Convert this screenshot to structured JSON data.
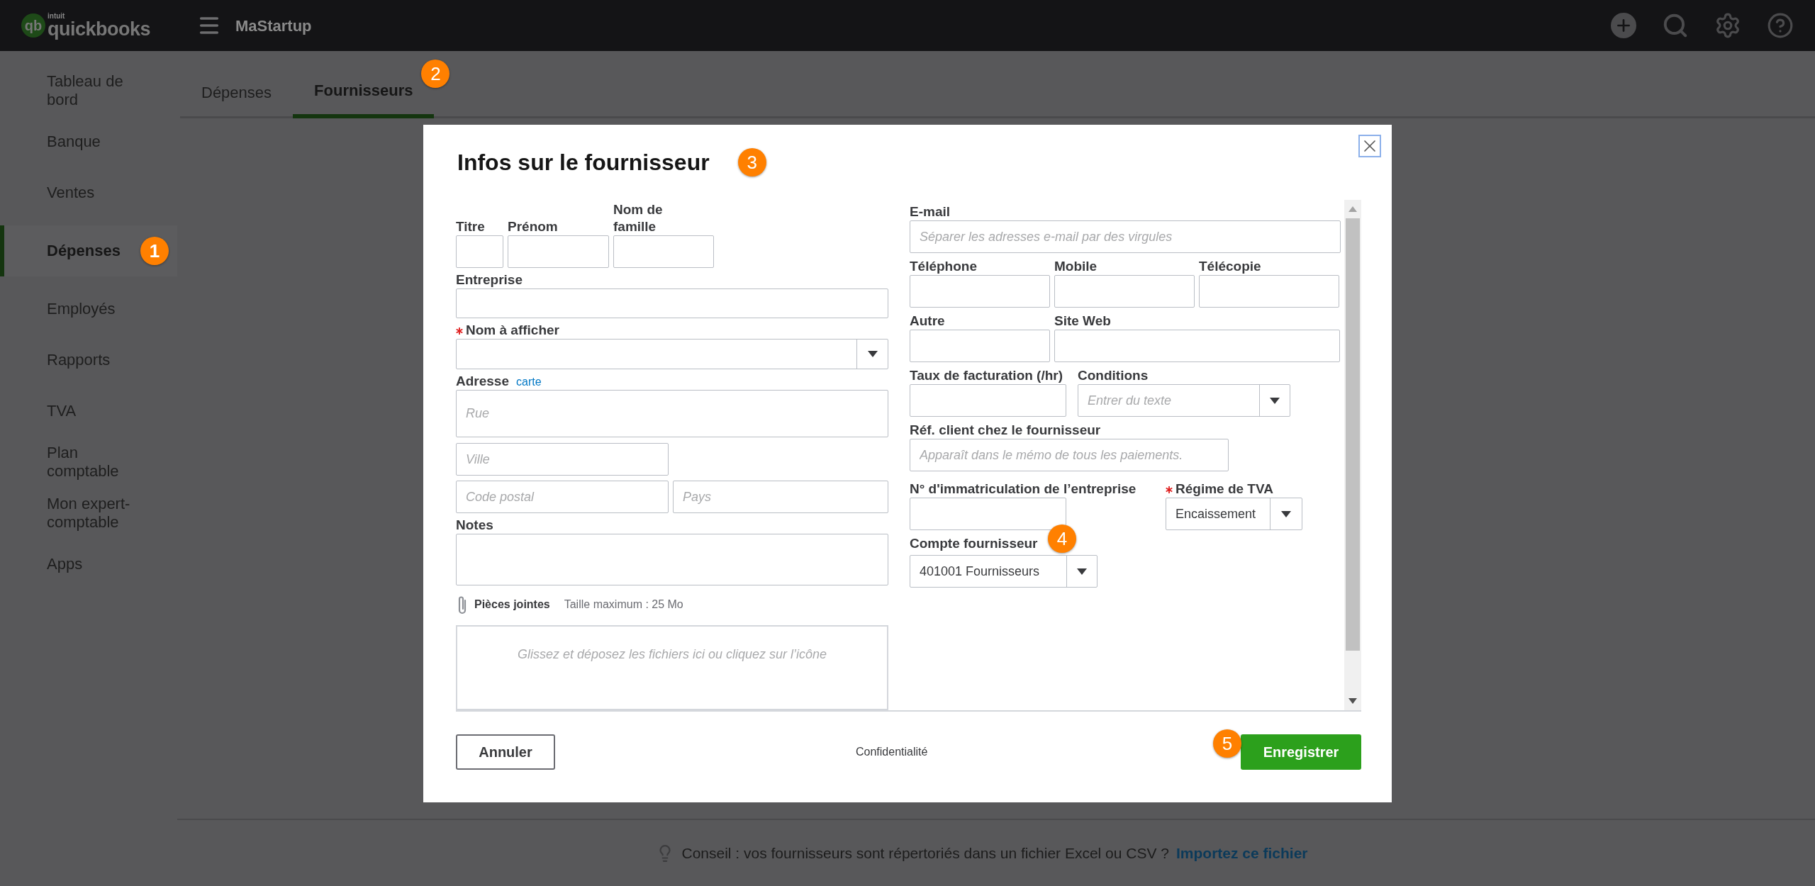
{
  "header": {
    "logo_mark": "qb",
    "brand_small": "intuit",
    "brand": "quickbooks",
    "company": "MaStartup"
  },
  "sidebar": {
    "items": [
      {
        "label": "Tableau de bord",
        "selected": false
      },
      {
        "label": "Banque",
        "selected": false
      },
      {
        "label": "Ventes",
        "selected": false
      },
      {
        "label": "Dépenses",
        "selected": true,
        "callout": "1"
      },
      {
        "label": "Employés",
        "selected": false
      },
      {
        "label": "Rapports",
        "selected": false
      },
      {
        "label": "TVA",
        "selected": false
      },
      {
        "label": "Plan comptable",
        "selected": false
      },
      {
        "label": "Mon expert-comptable",
        "selected": false
      },
      {
        "label": "Apps",
        "selected": false
      }
    ]
  },
  "tabs": [
    {
      "label": "Dépenses",
      "selected": false
    },
    {
      "label": "Fournisseurs",
      "selected": true,
      "callout": "2"
    }
  ],
  "dialog": {
    "title": "Infos sur le fournisseur",
    "callout": "3",
    "name_fields": [
      {
        "label": "Titre"
      },
      {
        "label": "Prénom"
      },
      {
        "label": "Nom de famille"
      }
    ],
    "company": {
      "label": "Entreprise"
    },
    "display_name": {
      "label": "Nom à afficher",
      "required": true
    },
    "address": {
      "label": "Adresse",
      "link": "carte",
      "fields": [
        {
          "placeholder": "Rue"
        },
        {
          "placeholder": "Ville"
        },
        {
          "placeholder": "Code postal"
        },
        {
          "placeholder": "Pays"
        }
      ]
    },
    "notes": {
      "label": "Notes"
    },
    "attachments": {
      "label": "Pièces jointes",
      "limit": "Taille maximum : 25 Mo",
      "drop_hint": "Glissez et déposez les fichiers ici ou cliquez sur l’icône"
    },
    "email": {
      "label": "E-mail",
      "placeholder": "Séparer les adresses e-mail par des virgules"
    },
    "phones": [
      {
        "label": "Téléphone"
      },
      {
        "label": "Mobile"
      },
      {
        "label": "Télécopie"
      }
    ],
    "other": {
      "label": "Autre"
    },
    "website": {
      "label": "Site Web"
    },
    "billing_rate": {
      "label": "Taux de facturation (/hr)"
    },
    "terms": {
      "label": "Conditions",
      "placeholder": "Entrer du texte"
    },
    "account_no": {
      "label": "Réf. client chez le fournisseur",
      "placeholder": "Apparaît dans le mémo de tous les paiements."
    },
    "registration": {
      "label": "N° d'immatriculation de l’entreprise"
    },
    "vat_regime": {
      "label": "Régime de TVA",
      "required": true,
      "value": "Encaissement"
    },
    "supplier_account": {
      "label": "Compte fournisseur",
      "value": "401001 Fournisseurs",
      "callout": "4"
    },
    "cancel": "Annuler",
    "privacy": "Confidentialité",
    "save": {
      "label": "Enregistrer",
      "callout": "5"
    }
  },
  "tip": {
    "text": "Conseil : vos fournisseurs sont répertoriés dans un fichier Excel ou CSV ?",
    "link": "Importez ce fichier"
  }
}
